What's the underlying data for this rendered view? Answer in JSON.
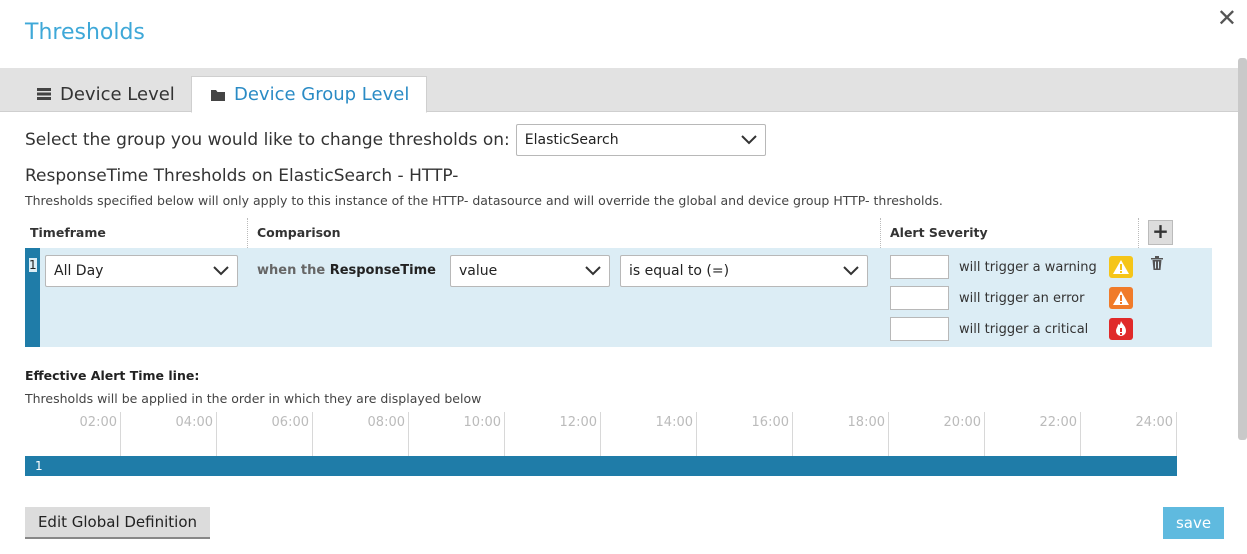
{
  "dialog": {
    "title": "Thresholds",
    "close_glyph": "✕"
  },
  "tabs": [
    {
      "label": "Device Level",
      "icon": "server-icon"
    },
    {
      "label": "Device Group Level",
      "icon": "folder-icon",
      "active": true
    }
  ],
  "group_select": {
    "label": "Select the group you would like to change thresholds on:",
    "value": "ElasticSearch"
  },
  "section": {
    "title": "ResponseTime Thresholds on ElasticSearch - HTTP-",
    "description": "Thresholds specified below will only apply to this instance of the HTTP- datasource and will override the global and device group HTTP- thresholds."
  },
  "table": {
    "headers": {
      "timeframe": "Timeframe",
      "comparison": "Comparison",
      "severity": "Alert Severity"
    },
    "add_glyph": "+",
    "row": {
      "number": "1",
      "timeframe": "All Day",
      "when_prefix": "when the",
      "metric": "ResponseTime",
      "value_type": "value",
      "operator": "is equal to (=)",
      "severities": [
        {
          "label": "will trigger a warning",
          "value": "",
          "icon": "warning-icon",
          "color": "#f5c518"
        },
        {
          "label": "will trigger an error",
          "value": "",
          "icon": "error-icon",
          "color": "#f07b2a"
        },
        {
          "label": "will trigger a critical",
          "value": "",
          "icon": "critical-icon",
          "color": "#e02a2a"
        }
      ]
    }
  },
  "timeline": {
    "title": "Effective Alert Time line:",
    "description": "Thresholds will be applied in the order in which they are displayed below",
    "ticks": [
      "02:00",
      "04:00",
      "06:00",
      "08:00",
      "10:00",
      "12:00",
      "14:00",
      "16:00",
      "18:00",
      "20:00",
      "22:00",
      "24:00"
    ],
    "bar_label": "1",
    "bar_color": "#1f7ca8"
  },
  "buttons": {
    "edit_global": "Edit Global Definition",
    "save": "save"
  }
}
